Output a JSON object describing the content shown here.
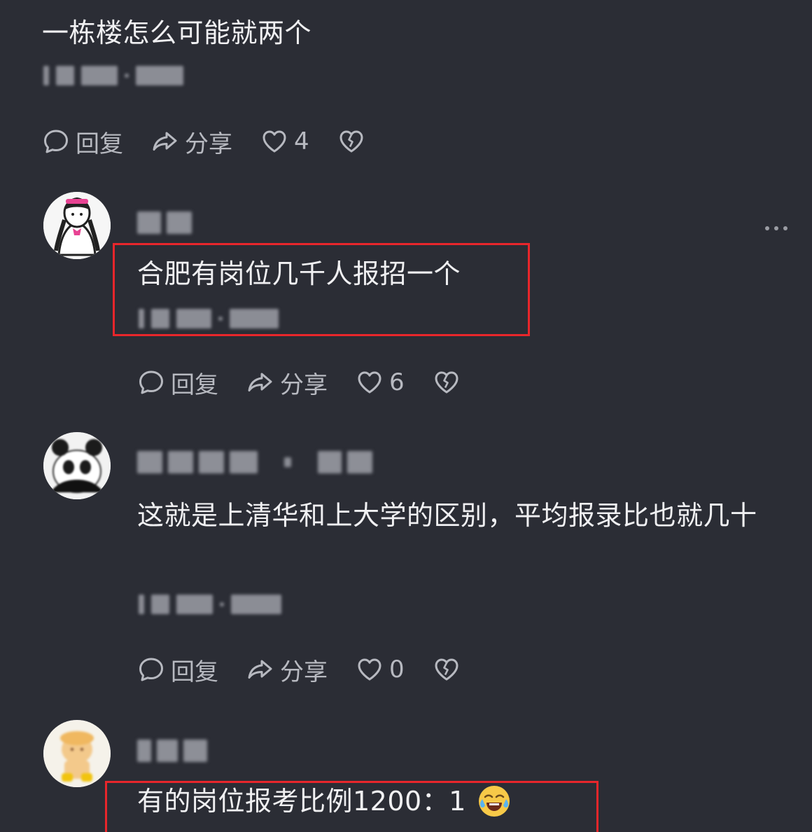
{
  "comments": [
    {
      "text": "一栋楼怎么可能就两个",
      "actions": {
        "reply_label": "回复",
        "share_label": "分享",
        "like_count": "4"
      }
    },
    {
      "text": "合肥有岗位几千人报招一个",
      "actions": {
        "reply_label": "回复",
        "share_label": "分享",
        "like_count": "6"
      }
    },
    {
      "text": "这就是上清华和上大学的区别，平均报录比也就几十",
      "actions": {
        "reply_label": "回复",
        "share_label": "分享",
        "like_count": "0"
      }
    },
    {
      "text": "有的岗位报考比例1200：1",
      "emoji": "laughing-crying-emoji"
    }
  ],
  "colors": {
    "background": "#2b2d35",
    "highlight": "#e8262b",
    "text": "#f0f0f2",
    "muted": "#b7b9c0"
  },
  "icons": [
    "comment-bubble-icon",
    "share-arrow-icon",
    "heart-icon",
    "broken-heart-icon",
    "more-dots-icon"
  ]
}
